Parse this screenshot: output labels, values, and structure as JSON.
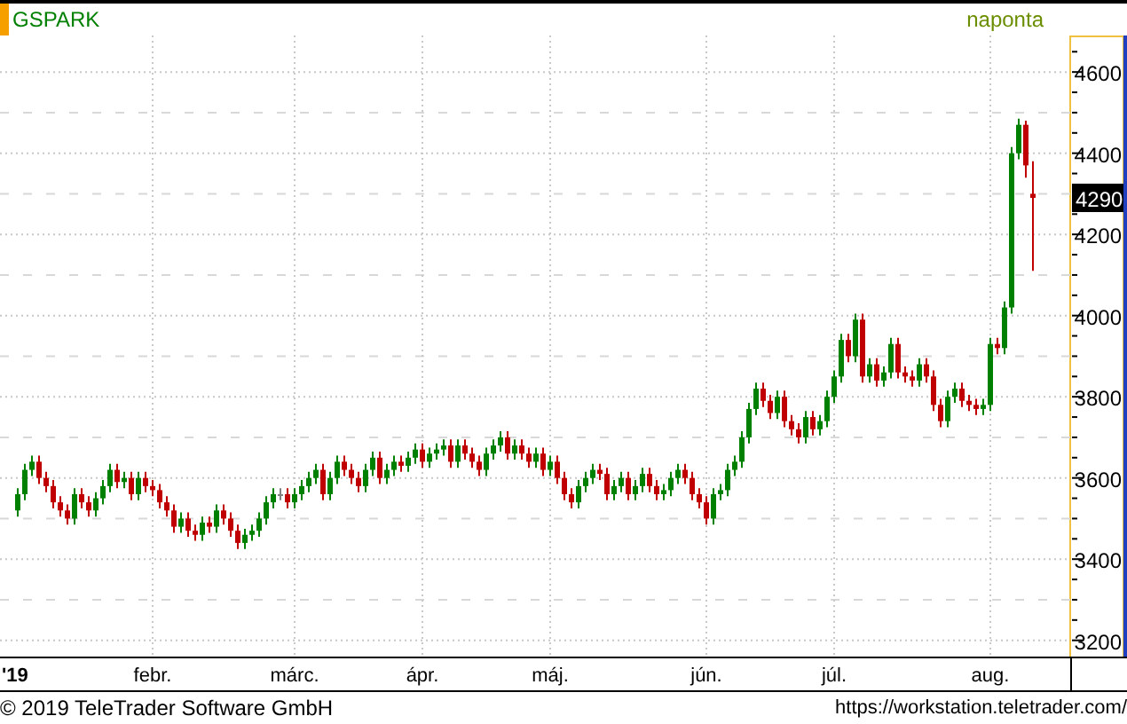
{
  "header": {
    "symbol": "GSPARK",
    "interval": "naponta"
  },
  "chart": {
    "chart_data": {
      "type": "candlestick",
      "grid": true,
      "yticks": [
        3200,
        3400,
        3600,
        3800,
        4000,
        4200,
        4400,
        4600
      ],
      "ylim": [
        3160,
        4690
      ],
      "categories": [
        "'19",
        null,
        null,
        null,
        null,
        null,
        null,
        null,
        null,
        null,
        null,
        null,
        null,
        null,
        null,
        null,
        null,
        null,
        null,
        "febr.",
        null,
        null,
        null,
        null,
        null,
        null,
        null,
        null,
        null,
        null,
        null,
        null,
        null,
        null,
        null,
        null,
        null,
        null,
        null,
        "márc.",
        null,
        null,
        null,
        null,
        null,
        null,
        null,
        null,
        null,
        null,
        null,
        null,
        null,
        null,
        null,
        null,
        null,
        "ápr.",
        null,
        null,
        null,
        null,
        null,
        null,
        null,
        null,
        null,
        null,
        null,
        null,
        null,
        null,
        null,
        null,
        null,
        "máj.",
        null,
        null,
        null,
        null,
        null,
        null,
        null,
        null,
        null,
        null,
        null,
        null,
        null,
        null,
        null,
        null,
        null,
        null,
        null,
        null,
        null,
        "jún.",
        null,
        null,
        null,
        null,
        null,
        null,
        null,
        null,
        null,
        null,
        null,
        null,
        null,
        null,
        null,
        null,
        null,
        "júl.",
        null,
        null,
        null,
        null,
        null,
        null,
        null,
        null,
        null,
        null,
        null,
        null,
        null,
        null,
        null,
        null,
        null,
        null,
        null,
        null,
        null,
        "aug.",
        null,
        null,
        null,
        null,
        null,
        null
      ],
      "ohlc": [
        [
          3520,
          3575,
          3505,
          3560
        ],
        [
          3560,
          3635,
          3545,
          3620
        ],
        [
          3620,
          3655,
          3605,
          3640
        ],
        [
          3640,
          3655,
          3585,
          3600
        ],
        [
          3600,
          3615,
          3565,
          3580
        ],
        [
          3580,
          3595,
          3525,
          3540
        ],
        [
          3540,
          3555,
          3505,
          3520
        ],
        [
          3520,
          3535,
          3485,
          3500
        ],
        [
          3500,
          3575,
          3485,
          3560
        ],
        [
          3560,
          3575,
          3525,
          3540
        ],
        [
          3540,
          3555,
          3505,
          3520
        ],
        [
          3520,
          3565,
          3505,
          3550
        ],
        [
          3550,
          3595,
          3535,
          3580
        ],
        [
          3580,
          3635,
          3565,
          3620
        ],
        [
          3620,
          3635,
          3575,
          3590
        ],
        [
          3590,
          3615,
          3575,
          3600
        ],
        [
          3600,
          3615,
          3545,
          3560
        ],
        [
          3560,
          3615,
          3545,
          3600
        ],
        [
          3600,
          3615,
          3565,
          3580
        ],
        [
          3580,
          3595,
          3555,
          3570
        ],
        [
          3570,
          3585,
          3525,
          3540
        ],
        [
          3540,
          3555,
          3505,
          3520
        ],
        [
          3520,
          3535,
          3465,
          3480
        ],
        [
          3480,
          3515,
          3465,
          3500
        ],
        [
          3500,
          3515,
          3455,
          3470
        ],
        [
          3470,
          3485,
          3445,
          3460
        ],
        [
          3460,
          3505,
          3445,
          3490
        ],
        [
          3490,
          3505,
          3465,
          3480
        ],
        [
          3480,
          3535,
          3465,
          3520
        ],
        [
          3520,
          3535,
          3485,
          3500
        ],
        [
          3500,
          3515,
          3455,
          3470
        ],
        [
          3470,
          3485,
          3425,
          3440
        ],
        [
          3440,
          3475,
          3425,
          3460
        ],
        [
          3460,
          3485,
          3445,
          3470
        ],
        [
          3470,
          3515,
          3455,
          3500
        ],
        [
          3500,
          3555,
          3485,
          3540
        ],
        [
          3540,
          3575,
          3525,
          3560
        ],
        [
          3560,
          3575,
          3545,
          3560
        ],
        [
          3560,
          3575,
          3525,
          3540
        ],
        [
          3540,
          3575,
          3525,
          3560
        ],
        [
          3560,
          3595,
          3545,
          3580
        ],
        [
          3580,
          3615,
          3565,
          3600
        ],
        [
          3600,
          3635,
          3585,
          3620
        ],
        [
          3620,
          3635,
          3545,
          3560
        ],
        [
          3560,
          3615,
          3545,
          3600
        ],
        [
          3600,
          3655,
          3585,
          3640
        ],
        [
          3640,
          3655,
          3605,
          3620
        ],
        [
          3620,
          3635,
          3585,
          3600
        ],
        [
          3600,
          3615,
          3565,
          3580
        ],
        [
          3580,
          3635,
          3565,
          3620
        ],
        [
          3620,
          3665,
          3605,
          3650
        ],
        [
          3650,
          3665,
          3585,
          3600
        ],
        [
          3600,
          3635,
          3585,
          3620
        ],
        [
          3620,
          3655,
          3605,
          3640
        ],
        [
          3640,
          3655,
          3615,
          3630
        ],
        [
          3630,
          3665,
          3615,
          3650
        ],
        [
          3650,
          3685,
          3635,
          3670
        ],
        [
          3670,
          3685,
          3625,
          3640
        ],
        [
          3640,
          3675,
          3625,
          3660
        ],
        [
          3660,
          3685,
          3645,
          3670
        ],
        [
          3670,
          3695,
          3655,
          3680
        ],
        [
          3680,
          3695,
          3625,
          3640
        ],
        [
          3640,
          3695,
          3625,
          3680
        ],
        [
          3680,
          3695,
          3645,
          3660
        ],
        [
          3660,
          3675,
          3625,
          3640
        ],
        [
          3640,
          3655,
          3605,
          3620
        ],
        [
          3620,
          3675,
          3605,
          3660
        ],
        [
          3660,
          3695,
          3645,
          3680
        ],
        [
          3680,
          3715,
          3665,
          3700
        ],
        [
          3700,
          3715,
          3645,
          3660
        ],
        [
          3660,
          3695,
          3645,
          3680
        ],
        [
          3680,
          3695,
          3645,
          3660
        ],
        [
          3660,
          3675,
          3625,
          3640
        ],
        [
          3640,
          3675,
          3625,
          3660
        ],
        [
          3660,
          3675,
          3605,
          3620
        ],
        [
          3620,
          3655,
          3605,
          3640
        ],
        [
          3640,
          3655,
          3585,
          3600
        ],
        [
          3600,
          3615,
          3545,
          3560
        ],
        [
          3560,
          3575,
          3525,
          3540
        ],
        [
          3540,
          3595,
          3525,
          3580
        ],
        [
          3580,
          3615,
          3565,
          3600
        ],
        [
          3600,
          3635,
          3585,
          3620
        ],
        [
          3620,
          3635,
          3595,
          3610
        ],
        [
          3610,
          3625,
          3545,
          3560
        ],
        [
          3560,
          3595,
          3545,
          3580
        ],
        [
          3580,
          3615,
          3565,
          3600
        ],
        [
          3600,
          3615,
          3545,
          3560
        ],
        [
          3560,
          3595,
          3545,
          3580
        ],
        [
          3580,
          3625,
          3565,
          3610
        ],
        [
          3610,
          3625,
          3565,
          3580
        ],
        [
          3580,
          3595,
          3545,
          3560
        ],
        [
          3560,
          3585,
          3545,
          3570
        ],
        [
          3570,
          3615,
          3555,
          3600
        ],
        [
          3600,
          3635,
          3585,
          3620
        ],
        [
          3620,
          3635,
          3585,
          3600
        ],
        [
          3600,
          3615,
          3545,
          3560
        ],
        [
          3560,
          3575,
          3525,
          3540
        ],
        [
          3540,
          3555,
          3485,
          3500
        ],
        [
          3500,
          3575,
          3485,
          3560
        ],
        [
          3560,
          3585,
          3545,
          3570
        ],
        [
          3570,
          3635,
          3555,
          3620
        ],
        [
          3620,
          3655,
          3605,
          3640
        ],
        [
          3640,
          3715,
          3625,
          3700
        ],
        [
          3700,
          3785,
          3685,
          3770
        ],
        [
          3770,
          3835,
          3755,
          3820
        ],
        [
          3820,
          3835,
          3775,
          3790
        ],
        [
          3790,
          3805,
          3745,
          3760
        ],
        [
          3760,
          3815,
          3745,
          3800
        ],
        [
          3800,
          3815,
          3725,
          3740
        ],
        [
          3740,
          3755,
          3705,
          3720
        ],
        [
          3720,
          3735,
          3685,
          3700
        ],
        [
          3700,
          3765,
          3685,
          3750
        ],
        [
          3750,
          3765,
          3705,
          3720
        ],
        [
          3720,
          3755,
          3705,
          3740
        ],
        [
          3740,
          3815,
          3725,
          3800
        ],
        [
          3800,
          3865,
          3785,
          3850
        ],
        [
          3850,
          3955,
          3835,
          3940
        ],
        [
          3940,
          3955,
          3885,
          3900
        ],
        [
          3900,
          4005,
          3885,
          3990
        ],
        [
          3990,
          4005,
          3835,
          3850
        ],
        [
          3850,
          3895,
          3835,
          3880
        ],
        [
          3880,
          3895,
          3825,
          3840
        ],
        [
          3840,
          3875,
          3825,
          3860
        ],
        [
          3860,
          3945,
          3845,
          3930
        ],
        [
          3930,
          3945,
          3845,
          3860
        ],
        [
          3860,
          3875,
          3835,
          3850
        ],
        [
          3850,
          3865,
          3825,
          3840
        ],
        [
          3840,
          3895,
          3825,
          3880
        ],
        [
          3880,
          3895,
          3835,
          3850
        ],
        [
          3850,
          3865,
          3765,
          3780
        ],
        [
          3780,
          3795,
          3725,
          3740
        ],
        [
          3740,
          3815,
          3725,
          3800
        ],
        [
          3800,
          3835,
          3785,
          3820
        ],
        [
          3820,
          3835,
          3775,
          3790
        ],
        [
          3790,
          3805,
          3765,
          3780
        ],
        [
          3780,
          3795,
          3755,
          3770
        ],
        [
          3770,
          3795,
          3755,
          3780
        ],
        [
          3780,
          3945,
          3765,
          3930
        ],
        [
          3930,
          3945,
          3905,
          3920
        ],
        [
          3920,
          4035,
          3905,
          4020
        ],
        [
          4020,
          4415,
          4005,
          4400
        ],
        [
          4400,
          4485,
          4385,
          4470
        ],
        [
          4470,
          4480,
          4340,
          4370
        ],
        [
          4300,
          4380,
          4110,
          4290
        ]
      ]
    },
    "last_price": "4290"
  },
  "footer": {
    "copyright": "© 2019 TeleTrader Software GmbH",
    "url": "https://workstation.teletrader.com/"
  }
}
